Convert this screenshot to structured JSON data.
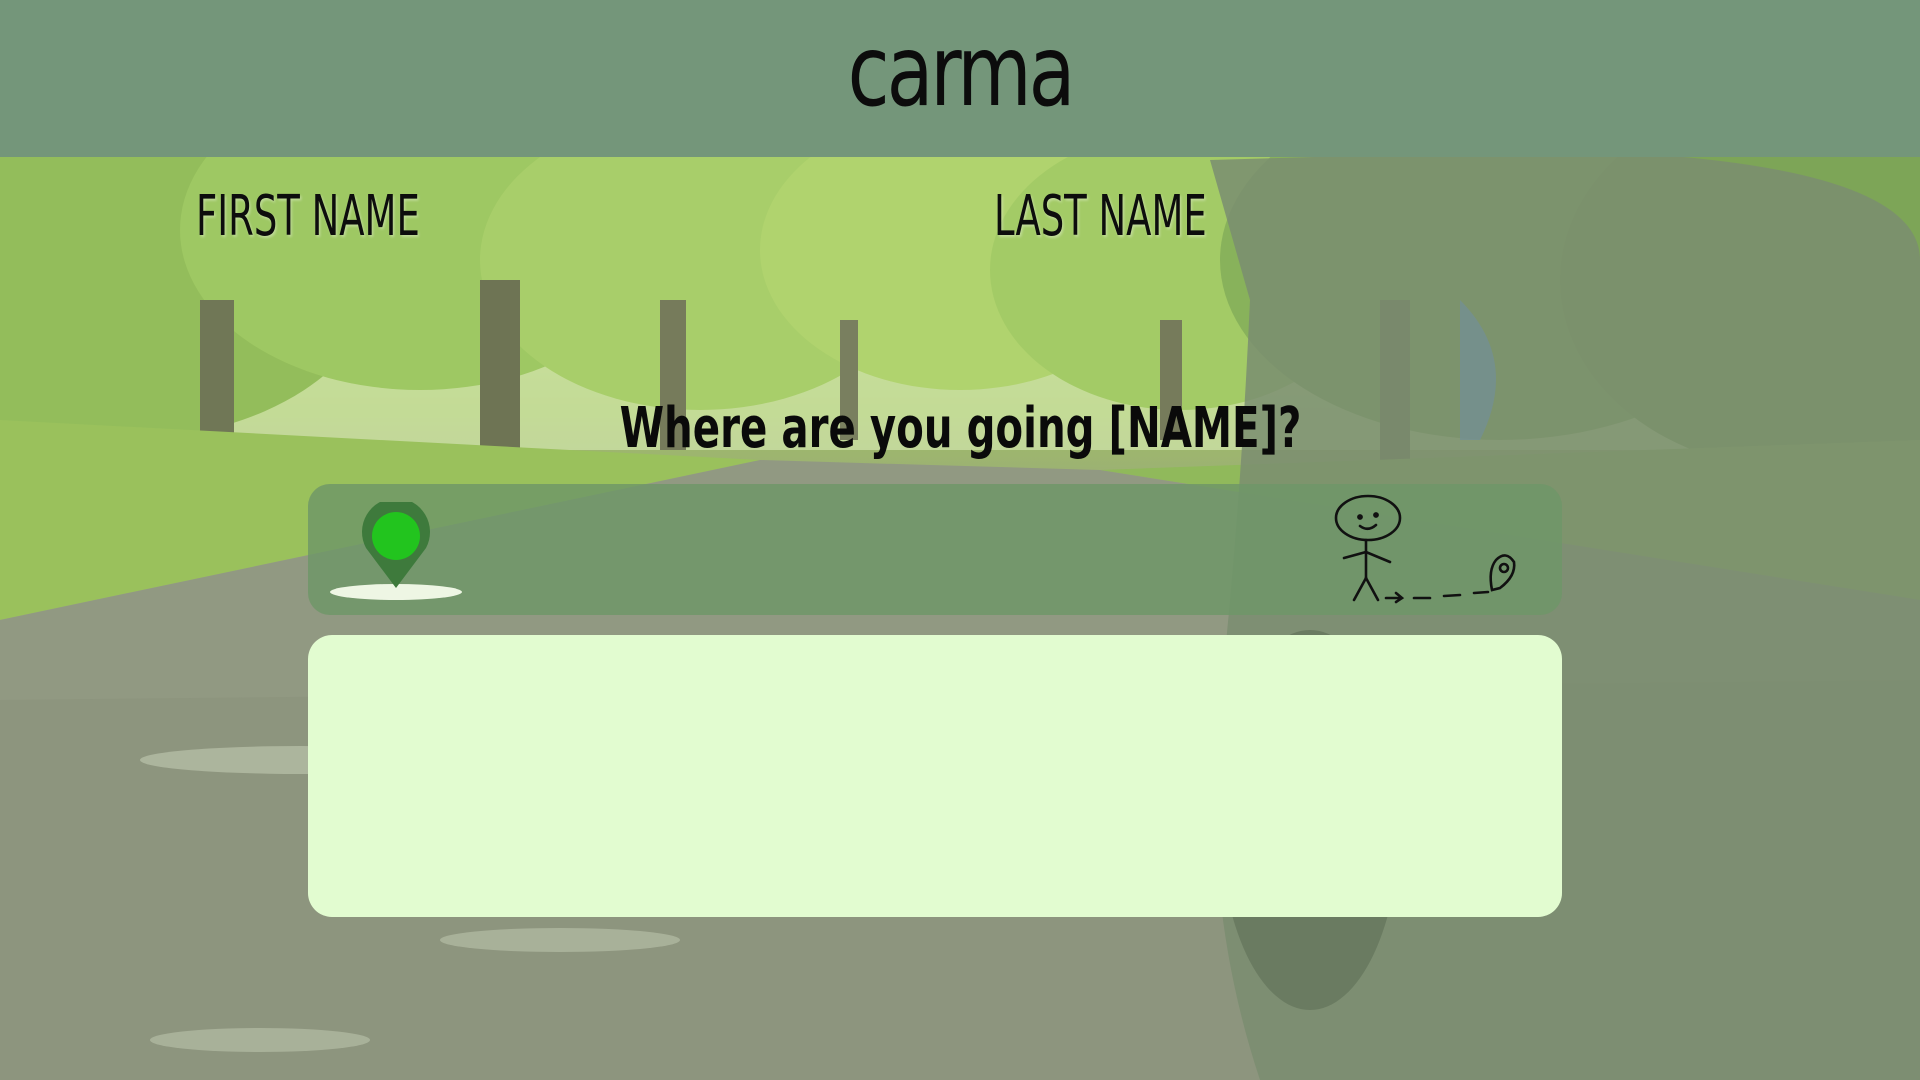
{
  "app": {
    "title": "carma"
  },
  "user": {
    "first_name_label": "FIRST NAME",
    "last_name_label": "LAST NAME"
  },
  "destination": {
    "prompt": "Where are you going [NAME]?",
    "input_value": "",
    "pin_icon": "location-pin-icon",
    "walk_icon": "walking-stick-figure-icon"
  },
  "results": {
    "items": []
  },
  "colors": {
    "header": "#74967a",
    "destination_bar": "#6e9668",
    "results_panel": "#e2fcd0",
    "pin": "#3a7d3a",
    "pin_dot": "#22c41e"
  }
}
